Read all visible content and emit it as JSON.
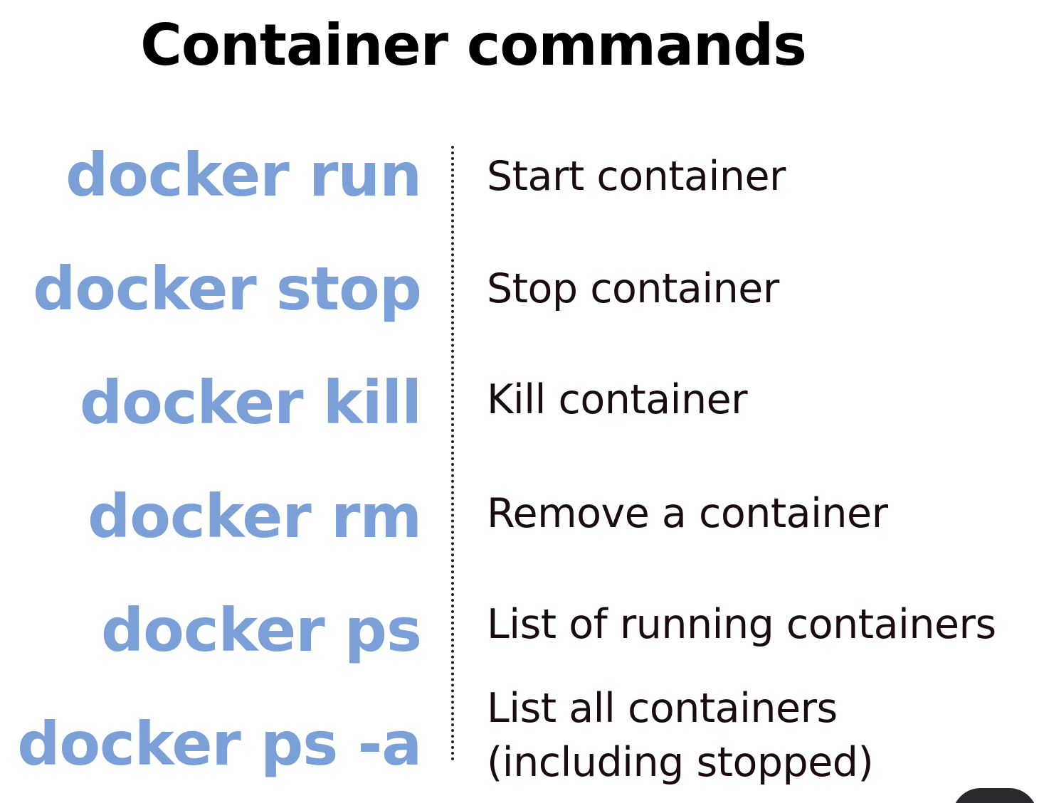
{
  "title": "Container commands",
  "rows": [
    {
      "command": "docker run",
      "description": "Start container"
    },
    {
      "command": "docker stop",
      "description": "Stop container"
    },
    {
      "command": "docker kill",
      "description": "Kill container"
    },
    {
      "command": "docker rm",
      "description": "Remove a container"
    },
    {
      "command": "docker ps",
      "description": "List of running containers"
    },
    {
      "command": "docker ps -a",
      "description_lines": [
        "List all containers",
        "(including stopped)"
      ]
    }
  ],
  "colors": {
    "command": "#7ba0d8",
    "description": "#1a0a12",
    "title": "#000000"
  }
}
